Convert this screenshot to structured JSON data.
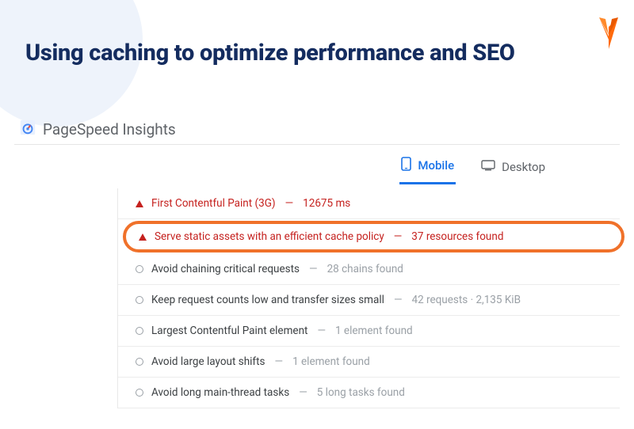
{
  "title": "Using caching to optimize performance and SEO",
  "psi": {
    "name": "PageSpeed Insights"
  },
  "tabs": {
    "mobile": "Mobile",
    "desktop": "Desktop",
    "active": "mobile"
  },
  "audits": [
    {
      "status": "red",
      "title": "First Contentful Paint (3G)",
      "detail": "12675 ms"
    },
    {
      "status": "red",
      "highlight": true,
      "title": "Serve static assets with an efficient cache policy",
      "detail": "37 resources found"
    },
    {
      "status": "gray",
      "title": "Avoid chaining critical requests",
      "detail": "28 chains found"
    },
    {
      "status": "gray",
      "title": "Keep request counts low and transfer sizes small",
      "detail": "42 requests · 2,135 KiB"
    },
    {
      "status": "gray",
      "title": "Largest Contentful Paint element",
      "detail": "1 element found"
    },
    {
      "status": "gray",
      "title": "Avoid large layout shifts",
      "detail": "1 element found"
    },
    {
      "status": "gray",
      "title": "Avoid long main-thread tasks",
      "detail": "5 long tasks found"
    }
  ]
}
